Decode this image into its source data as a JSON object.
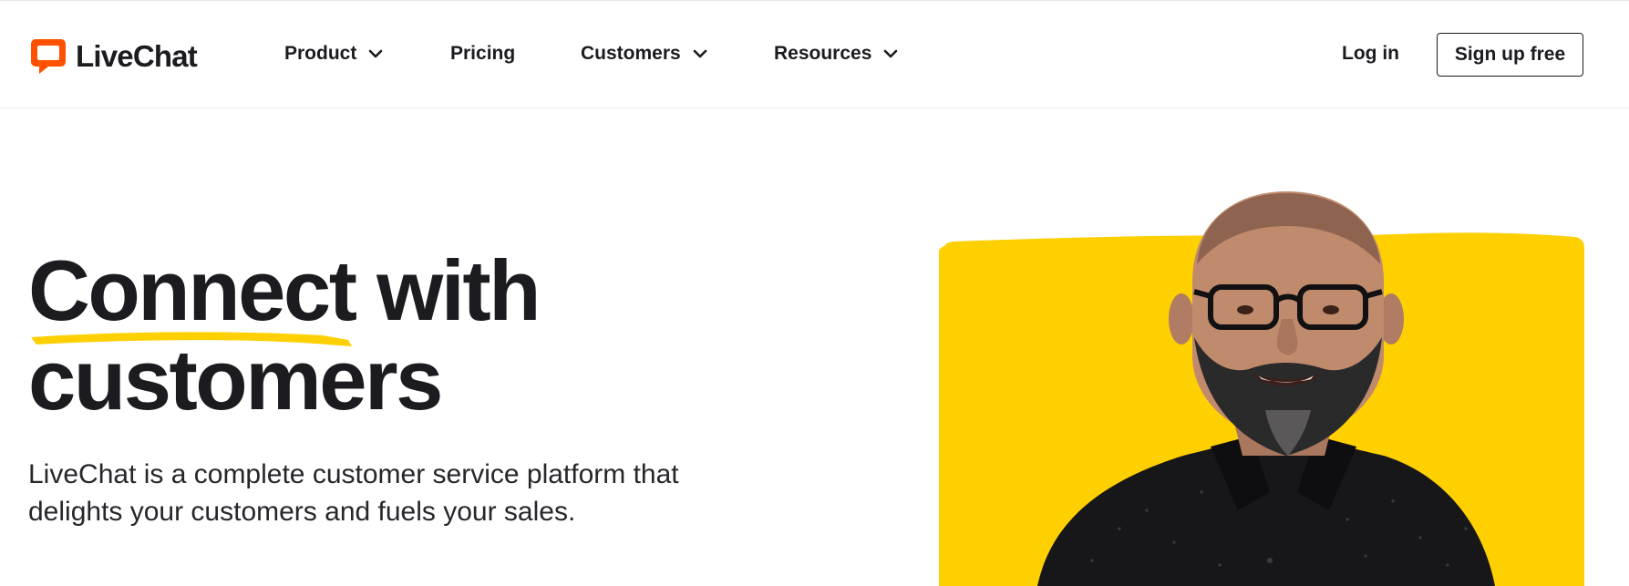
{
  "brand": {
    "name": "LiveChat",
    "accent_color": "#FF5100",
    "highlight_color": "#FFD000",
    "logo_icon": "speech-bubble-icon"
  },
  "nav": {
    "items": [
      {
        "label": "Product",
        "has_dropdown": true
      },
      {
        "label": "Pricing",
        "has_dropdown": false
      },
      {
        "label": "Customers",
        "has_dropdown": true
      },
      {
        "label": "Resources",
        "has_dropdown": true
      }
    ],
    "login_label": "Log in",
    "signup_label": "Sign up free"
  },
  "hero": {
    "title_word_1": "Connect",
    "title_word_2": "with",
    "title_line_2": "customers",
    "description": "LiveChat is a complete customer service platform that delights your customers and fuels your sales.",
    "image_alt": "Smiling man with glasses and a beard on a yellow background"
  }
}
